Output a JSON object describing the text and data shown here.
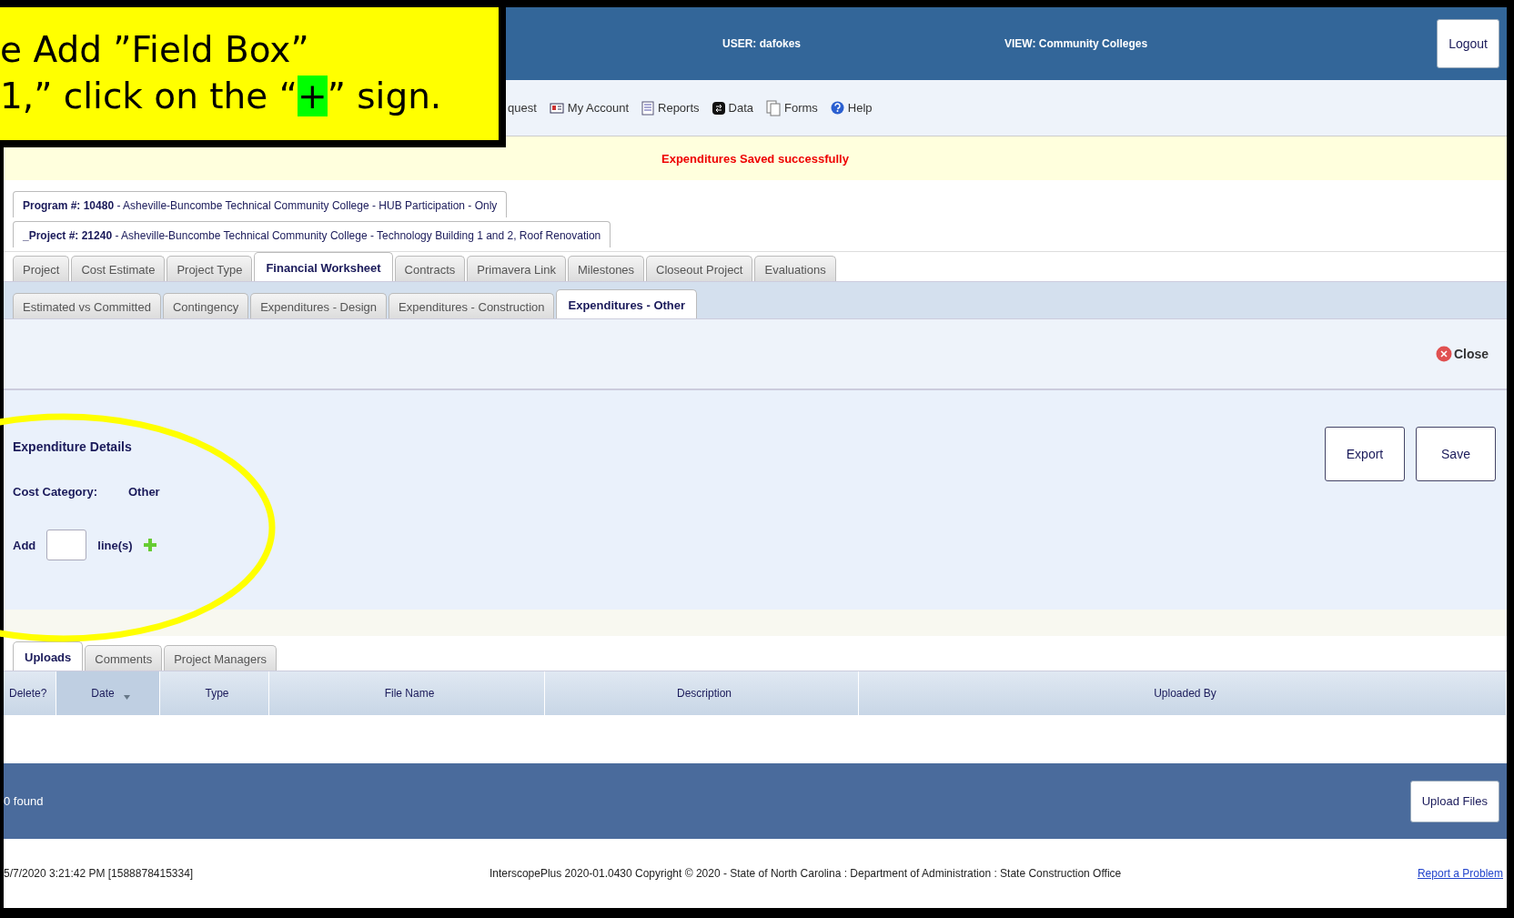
{
  "callout": {
    "line1": "e Add ”Field Box”",
    "line2_before": "1,” click on the “",
    "line2_highlight": "+",
    "line2_after": "” sign."
  },
  "header": {
    "user": "USER: dafokes",
    "view": "VIEW: Community Colleges",
    "logout": "Logout"
  },
  "menu": [
    {
      "label": "quest"
    },
    {
      "label": "My Account"
    },
    {
      "label": "Reports"
    },
    {
      "label": "Data"
    },
    {
      "label": "Forms"
    },
    {
      "label": "Help"
    }
  ],
  "message": "Expenditures Saved successfully",
  "program_tab": {
    "label": "Program #: 10480",
    "text": " - Asheville-Buncombe Technical Community College - HUB Participation - Only"
  },
  "project_tab": {
    "label": "_Project #: 21240",
    "text": " - Asheville-Buncombe Technical Community College - Technology Building 1 and 2, Roof Renovation"
  },
  "tabs": [
    {
      "label": "Project",
      "selected": false
    },
    {
      "label": "Cost Estimate",
      "selected": false
    },
    {
      "label": "Project Type",
      "selected": false
    },
    {
      "label": "Financial Worksheet",
      "selected": true
    },
    {
      "label": "Contracts",
      "selected": false
    },
    {
      "label": "Primavera Link",
      "selected": false
    },
    {
      "label": "Milestones",
      "selected": false
    },
    {
      "label": "Closeout Project",
      "selected": false
    },
    {
      "label": "Evaluations",
      "selected": false
    }
  ],
  "sub_tabs": [
    {
      "label": "Estimated vs Committed",
      "selected": false
    },
    {
      "label": "Contingency",
      "selected": false
    },
    {
      "label": "Expenditures - Design",
      "selected": false
    },
    {
      "label": "Expenditures - Construction",
      "selected": false
    },
    {
      "label": "Expenditures - Other",
      "selected": true
    }
  ],
  "close": "Close",
  "form": {
    "title": "Expenditure Details",
    "category_label": "Cost Category:",
    "category_value": "Other",
    "add_label": "Add",
    "lines_label": "line(s)",
    "export": "Export",
    "save": "Save"
  },
  "bottom_tabs": [
    {
      "label": "Uploads",
      "selected": true
    },
    {
      "label": "Comments",
      "selected": false
    },
    {
      "label": "Project Managers",
      "selected": false
    }
  ],
  "table": {
    "columns": [
      {
        "label": "Delete?",
        "sorted": false
      },
      {
        "label": "Date",
        "sorted": true
      },
      {
        "label": "Type",
        "sorted": false
      },
      {
        "label": "File Name",
        "sorted": false
      },
      {
        "label": "Description",
        "sorted": false
      },
      {
        "label": "Uploaded By",
        "sorted": false
      }
    ]
  },
  "footer": {
    "count": "0 found",
    "upload": "Upload Files"
  },
  "status_bar": {
    "timestamp": "5/7/2020 3:21:42 PM  [1588878415334]",
    "copyright": "InterscopePlus 2020-01.0430 Copyright © 2020 - State of North Carolina : Department of Administration : State Construction Office",
    "report": "Report a Problem"
  }
}
